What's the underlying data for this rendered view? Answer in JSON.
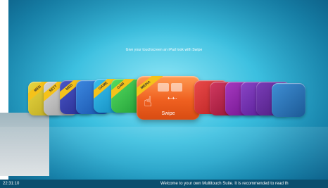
{
  "headline": "Give your touchscreen an iPad look with Swipe",
  "status": {
    "time": "22:31:10",
    "message": "Welcome to your own Multitouch Suite. It is recommended to read th"
  },
  "apps": [
    {
      "ribbon": "MED",
      "color": "#d7c52a"
    },
    {
      "ribbon": "SETT",
      "color": "#bdbdbd"
    },
    {
      "ribbon": "MED",
      "color": "#2f39a6"
    },
    {
      "ribbon": "",
      "color": "#1d63c7"
    },
    {
      "ribbon": "GAME",
      "color": "#1aa3d9"
    },
    {
      "ribbon": "GAM",
      "color": "#30c24c"
    },
    {
      "ribbon": "MEDIA",
      "label": "Swipe",
      "color": "#ef6020"
    },
    {
      "ribbon": "",
      "color": "#d02f2f"
    },
    {
      "ribbon": "",
      "color": "#b8183e"
    },
    {
      "ribbon": "",
      "color": "#8b1fa3"
    },
    {
      "ribbon": "",
      "color": "#6a2ea6"
    },
    {
      "ribbon": "",
      "color": "#2f72b6"
    }
  ]
}
